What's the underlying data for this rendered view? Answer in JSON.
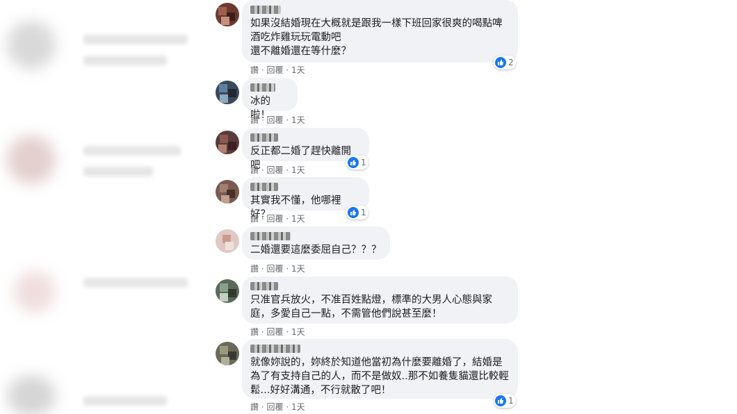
{
  "colors": {
    "bubble": "#f0f2f5",
    "text": "#1c1e21",
    "meta": "#65676b",
    "like": "#1877f2"
  },
  "comments": [
    {
      "text": "如果沒結婚現在大概就是跟我一樣下班回家很爽的喝點啤酒吃炸雞玩玩電動吧\n還不離婚還在等什麼？",
      "actions": {
        "like": "讚",
        "reply": "回覆",
        "time": "1天"
      },
      "reactions": "2"
    },
    {
      "text": "冰的啦！",
      "actions": {
        "like": "讚",
        "reply": "回覆",
        "time": "1天"
      },
      "reactions": ""
    },
    {
      "text": "反正都二婚了趕快離開吧",
      "actions": {
        "like": "讚",
        "reply": "回覆",
        "time": "1天"
      },
      "reactions": "1"
    },
    {
      "text": "其實我不懂，他哪裡好？",
      "actions": {
        "like": "讚",
        "reply": "回覆",
        "time": "1天"
      },
      "reactions": "1"
    },
    {
      "text": "二婚還要這麼委屈自己？？？",
      "actions": {
        "like": "讚",
        "reply": "回覆",
        "time": "1天"
      },
      "reactions": ""
    },
    {
      "text": "只准官兵放火，不准百姓點燈，標準的大男人心態與家庭，多愛自己一點，不需管他們說甚至麼！",
      "actions": {
        "like": "讚",
        "reply": "回覆",
        "time": "1天"
      },
      "reactions": ""
    },
    {
      "text": "就像妳說的，妳終於知道他當初為什麼要離婚了，結婚是為了有支持自己的人，而不是做奴..那不如養隻貓還比較輕鬆...好好溝通，不行就散了吧！",
      "actions": {
        "like": "讚",
        "reply": "回覆",
        "time": "1天"
      },
      "reactions": "1"
    }
  ]
}
